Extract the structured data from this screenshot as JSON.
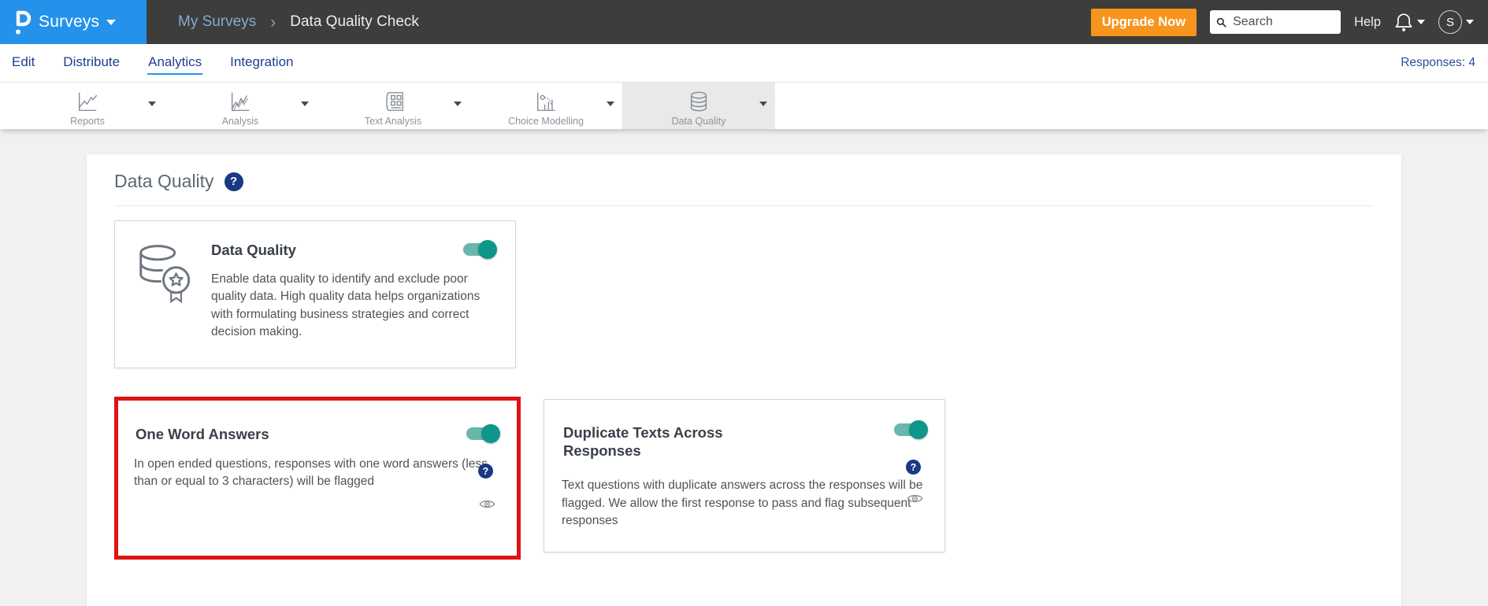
{
  "topbar": {
    "product": "Surveys",
    "breadcrumb": {
      "parent": "My Surveys",
      "separator": "›",
      "current": "Data Quality Check"
    },
    "upgrade_label": "Upgrade Now",
    "search_placeholder": "Search",
    "help_label": "Help",
    "avatar_initial": "S"
  },
  "nav": {
    "items": [
      {
        "label": "Edit"
      },
      {
        "label": "Distribute"
      },
      {
        "label": "Analytics",
        "active": true
      },
      {
        "label": "Integration"
      }
    ],
    "responses_label": "Responses: 4"
  },
  "toolbar": {
    "tabs": [
      {
        "label": "Reports",
        "icon": "line-chart-icon"
      },
      {
        "label": "Analysis",
        "icon": "multi-line-chart-icon"
      },
      {
        "label": "Text Analysis",
        "icon": "document-grid-icon"
      },
      {
        "label": "Choice Modelling",
        "icon": "model-chart-icon"
      },
      {
        "label": "Data Quality",
        "icon": "database-icon",
        "active": true
      }
    ]
  },
  "content": {
    "title": "Data Quality",
    "help_glyph": "?",
    "cards": {
      "data_quality": {
        "title": "Data Quality",
        "description": "Enable data quality to identify and exclude poor quality data. High quality data helps organizations with formulating business strategies and correct decision making.",
        "toggle": "on",
        "icon": "database-star-icon"
      },
      "one_word": {
        "title": "One Word Answers",
        "description": "In open ended questions, responses with one word answers (less than or equal to 3 characters) will be flagged",
        "toggle": "on",
        "highlighted": true
      },
      "duplicate": {
        "title": "Duplicate Texts Across Responses",
        "description": "Text questions with duplicate answers across the responses will be flagged. We allow the first response to pass and flag subsequent responses",
        "toggle": "on"
      }
    }
  },
  "colors": {
    "brand_blue": "#2492eb",
    "topbar_charcoal": "#3d3d3c",
    "accent_orange": "#f7941d",
    "nav_blue": "#1e3e92",
    "active_underline": "#2196f3",
    "toggle_track": "#68b6ac",
    "toggle_knob": "#0f968a",
    "help_navy": "#1a3984",
    "highlight_red": "#e01212"
  }
}
